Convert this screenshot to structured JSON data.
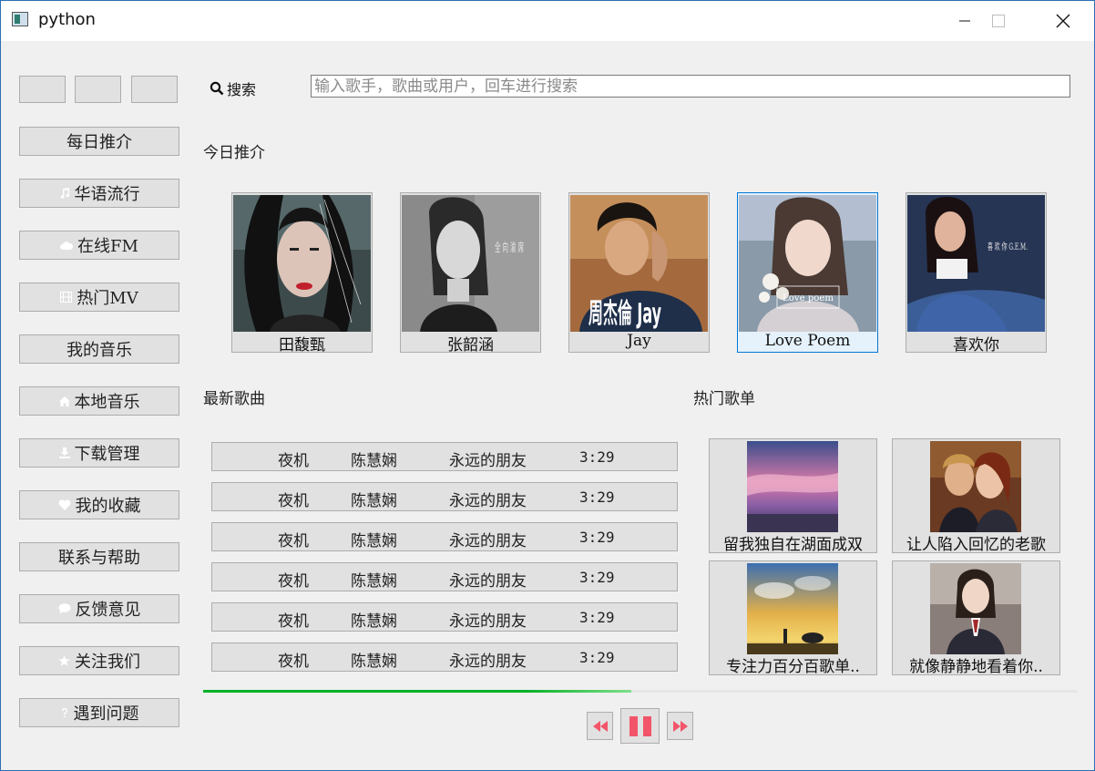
{
  "window": {
    "title": "python"
  },
  "search": {
    "label": "搜索",
    "placeholder": "输入歌手，歌曲或用户，回车进行搜索",
    "value": ""
  },
  "sidebar": {
    "items": [
      {
        "label": "每日推介",
        "icon": ""
      },
      {
        "label": "华语流行",
        "icon": "music-note-icon"
      },
      {
        "label": "在线FM",
        "icon": "cloud-icon"
      },
      {
        "label": "热门MV",
        "icon": "film-icon"
      },
      {
        "label": "我的音乐",
        "icon": ""
      },
      {
        "label": "本地音乐",
        "icon": "home-icon"
      },
      {
        "label": "下载管理",
        "icon": "download-icon"
      },
      {
        "label": "我的收藏",
        "icon": "heart-icon"
      },
      {
        "label": "联系与帮助",
        "icon": ""
      },
      {
        "label": "反馈意见",
        "icon": "comment-icon"
      },
      {
        "label": "关注我们",
        "icon": "star-icon"
      },
      {
        "label": "遇到问题",
        "icon": "question-icon"
      }
    ]
  },
  "today": {
    "title": "今日推介",
    "artists": [
      {
        "name": "田馥甄"
      },
      {
        "name": "张韶涵",
        "cover_text": "全 向 渝 席"
      },
      {
        "name": "Jay",
        "cover_text": "周杰倫 Jay"
      },
      {
        "name": "Love Poem",
        "cover_text": "Love poem"
      },
      {
        "name": "喜欢你",
        "cover_text": "喜 欢 你 G.E.M."
      }
    ]
  },
  "latest": {
    "title": "最新歌曲",
    "songs": [
      {
        "title": "夜机",
        "artist": "陈慧娴",
        "album": "永远的朋友",
        "duration": "3:29"
      },
      {
        "title": "夜机",
        "artist": "陈慧娴",
        "album": "永远的朋友",
        "duration": "3:29"
      },
      {
        "title": "夜机",
        "artist": "陈慧娴",
        "album": "永远的朋友",
        "duration": "3:29"
      },
      {
        "title": "夜机",
        "artist": "陈慧娴",
        "album": "永远的朋友",
        "duration": "3:29"
      },
      {
        "title": "夜机",
        "artist": "陈慧娴",
        "album": "永远的朋友",
        "duration": "3:29"
      },
      {
        "title": "夜机",
        "artist": "陈慧娴",
        "album": "永远的朋友",
        "duration": "3:29"
      }
    ]
  },
  "hot": {
    "title": "热门歌单",
    "playlists": [
      {
        "name": "留我独自在湖面成双"
      },
      {
        "name": "让人陷入回忆的老歌"
      },
      {
        "name": "专注力百分百歌单.."
      },
      {
        "name": "就像静静地看着你.."
      }
    ]
  },
  "player": {
    "progress": 0.49,
    "state": "playing"
  },
  "colors": {
    "accent": "#0078d7",
    "progress": "#06b025",
    "control_icon": "#f2556a"
  }
}
